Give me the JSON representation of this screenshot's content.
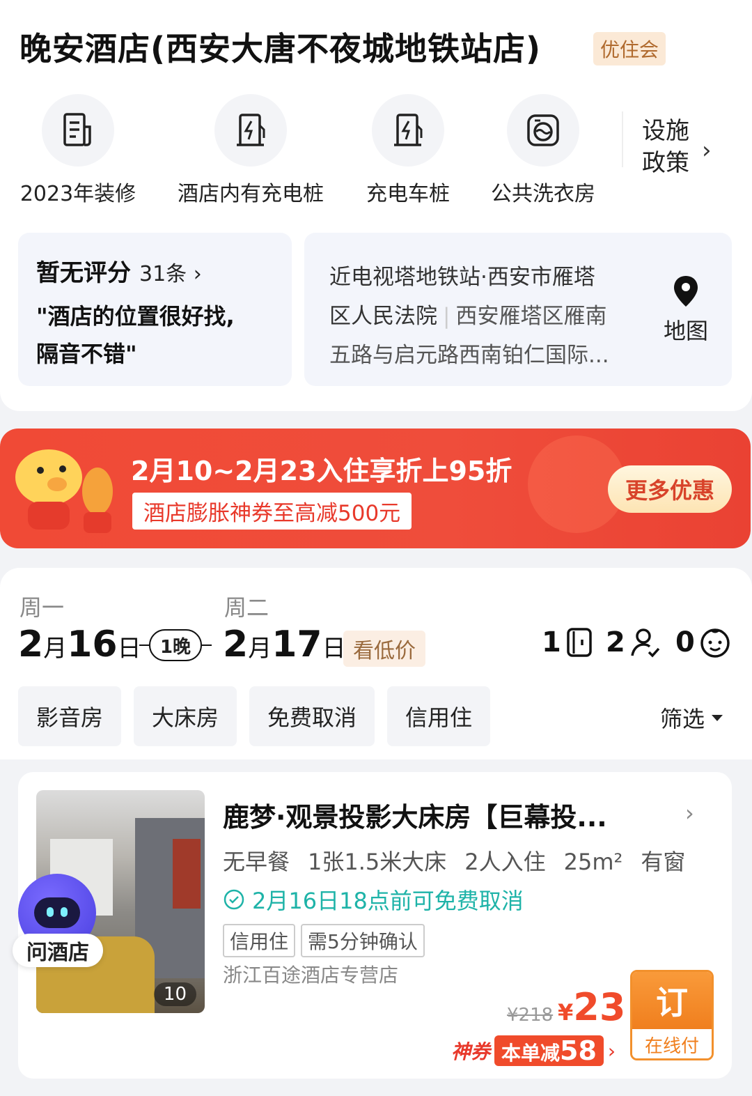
{
  "hotel": {
    "title": "晚安酒店(西安大唐不夜城地铁站店)",
    "member_badge": "优住会"
  },
  "facilities": [
    {
      "label": "2023年装修",
      "icon": "renovation-doc-icon"
    },
    {
      "label": "酒店内有充电桩",
      "icon": "charging-pile-icon"
    },
    {
      "label": "充电车桩",
      "icon": "charging-pile-icon"
    },
    {
      "label": "公共洗衣房",
      "icon": "washing-machine-icon"
    }
  ],
  "policy": {
    "line1": "设施",
    "line2": "政策",
    "arrow": "›"
  },
  "review": {
    "score_text": "暂无评分",
    "count_text": "31条 ›",
    "quote_line1": "\"酒店的位置很好找,",
    "quote_line2": "隔音不错\""
  },
  "address": {
    "line1": "近电视塔地铁站·西安市雁塔",
    "line2_a": "区人民法院",
    "line2_sep": "|",
    "line2_b": "西安雁塔区雁南",
    "line3": "五路与启元路西南铂仁国际...",
    "map_label": "地图"
  },
  "promo": {
    "title": "2月10~2月23入住享折上95折",
    "subtitle": "酒店膨胀神券至高减500元",
    "button": "更多优惠"
  },
  "dates": {
    "checkin_dow": "周一",
    "checkin_month": "2",
    "checkin_month_unit": "月",
    "checkin_day": "16",
    "checkin_day_unit": "日",
    "nights": "1晚",
    "checkout_dow": "周二",
    "checkout_month": "2",
    "checkout_month_unit": "月",
    "checkout_day": "17",
    "checkout_day_unit": "日",
    "low_price": "看低价"
  },
  "occupancy": {
    "rooms": "1",
    "adults": "2",
    "children": "0"
  },
  "filters": [
    "影音房",
    "大床房",
    "免费取消",
    "信用住"
  ],
  "filter_button": "筛选",
  "room": {
    "name": "鹿梦·观景投影大床房【巨幕投...",
    "info": [
      "无早餐",
      "1张1.5米大床",
      "2人入住",
      "25m²",
      "有窗"
    ],
    "cancel": "2月16日18点前可免费取消",
    "tags": [
      "信用住",
      "需5分钟确认"
    ],
    "shop": "浙江百途酒店专营店",
    "photo_count": "10",
    "price_old": "¥218",
    "currency": "¥",
    "price_now": "23",
    "coupon_label": "神券",
    "coupon_reduce_prefix": "本单减",
    "coupon_reduce_value": "58",
    "coupon_arrow": "›",
    "book_label": "订",
    "pay_label": "在线付"
  },
  "assistant": {
    "label": "问酒店"
  }
}
